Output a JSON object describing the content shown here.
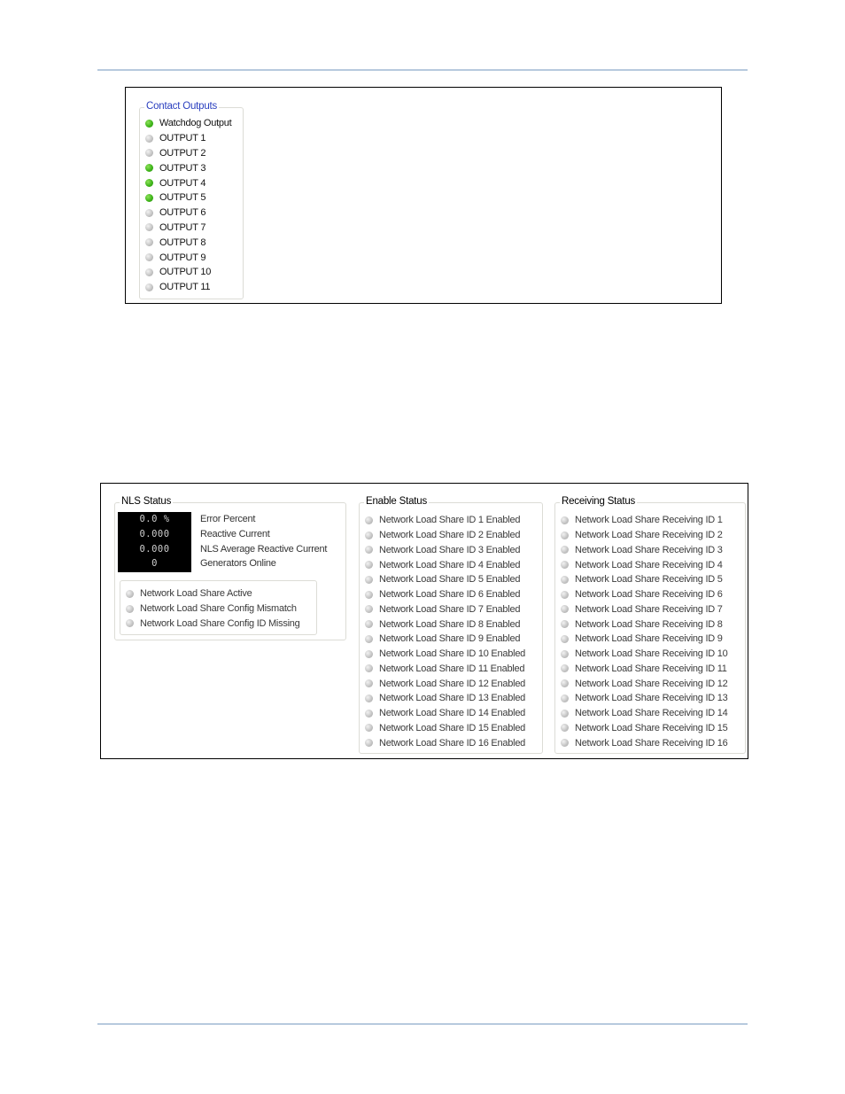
{
  "colors": {
    "led_on": "#3fb51a",
    "led_off": "#c6c6c6",
    "group_title_blue": "#2a3fbf",
    "page_rule": "#b7c9de",
    "meter_background": "#000000"
  },
  "contact_outputs": {
    "title": "Contact Outputs",
    "items": [
      {
        "label": "Watchdog Output",
        "state": "on"
      },
      {
        "label": "OUTPUT 1",
        "state": "off"
      },
      {
        "label": "OUTPUT 2",
        "state": "off"
      },
      {
        "label": "OUTPUT 3",
        "state": "on"
      },
      {
        "label": "OUTPUT 4",
        "state": "on"
      },
      {
        "label": "OUTPUT 5",
        "state": "on"
      },
      {
        "label": "OUTPUT 6",
        "state": "off"
      },
      {
        "label": "OUTPUT 7",
        "state": "off"
      },
      {
        "label": "OUTPUT 8",
        "state": "off"
      },
      {
        "label": "OUTPUT 9",
        "state": "off"
      },
      {
        "label": "OUTPUT 10",
        "state": "off"
      },
      {
        "label": "OUTPUT 11",
        "state": "off"
      }
    ]
  },
  "nls_status": {
    "title": "NLS Status",
    "meters": [
      {
        "value": "0.0 %",
        "label": "Error Percent"
      },
      {
        "value": "0.000",
        "label": "Reactive Current"
      },
      {
        "value": "0.000",
        "label": "NLS Average Reactive Current"
      },
      {
        "value": "0",
        "label": "Generators Online"
      }
    ],
    "indicators": [
      {
        "label": "Network Load Share Active",
        "state": "off"
      },
      {
        "label": "Network Load Share Config Mismatch",
        "state": "off"
      },
      {
        "label": "Network Load Share Config ID Missing",
        "state": "off"
      }
    ]
  },
  "enable_status": {
    "title": "Enable Status",
    "items": [
      {
        "label": "Network Load Share ID 1 Enabled",
        "state": "off"
      },
      {
        "label": "Network Load Share ID 2 Enabled",
        "state": "off"
      },
      {
        "label": "Network Load Share ID 3 Enabled",
        "state": "off"
      },
      {
        "label": "Network Load Share ID 4 Enabled",
        "state": "off"
      },
      {
        "label": "Network Load Share ID 5 Enabled",
        "state": "off"
      },
      {
        "label": "Network Load Share ID 6 Enabled",
        "state": "off"
      },
      {
        "label": "Network Load Share ID 7 Enabled",
        "state": "off"
      },
      {
        "label": "Network Load Share ID 8 Enabled",
        "state": "off"
      },
      {
        "label": "Network Load Share ID 9 Enabled",
        "state": "off"
      },
      {
        "label": "Network Load Share ID 10 Enabled",
        "state": "off"
      },
      {
        "label": "Network Load Share ID 11 Enabled",
        "state": "off"
      },
      {
        "label": "Network Load Share ID 12 Enabled",
        "state": "off"
      },
      {
        "label": "Network Load Share ID 13 Enabled",
        "state": "off"
      },
      {
        "label": "Network Load Share ID 14 Enabled",
        "state": "off"
      },
      {
        "label": "Network Load Share ID 15 Enabled",
        "state": "off"
      },
      {
        "label": "Network Load Share ID 16 Enabled",
        "state": "off"
      }
    ]
  },
  "receiving_status": {
    "title": "Receiving Status",
    "items": [
      {
        "label": "Network Load Share Receiving ID 1",
        "state": "off"
      },
      {
        "label": "Network Load Share Receiving ID 2",
        "state": "off"
      },
      {
        "label": "Network Load Share Receiving ID 3",
        "state": "off"
      },
      {
        "label": "Network Load Share Receiving ID 4",
        "state": "off"
      },
      {
        "label": "Network Load Share Receiving ID 5",
        "state": "off"
      },
      {
        "label": "Network Load Share Receiving ID 6",
        "state": "off"
      },
      {
        "label": "Network Load Share Receiving ID 7",
        "state": "off"
      },
      {
        "label": "Network Load Share Receiving ID 8",
        "state": "off"
      },
      {
        "label": "Network Load Share Receiving ID 9",
        "state": "off"
      },
      {
        "label": "Network Load Share Receiving ID 10",
        "state": "off"
      },
      {
        "label": "Network Load Share Receiving ID 11",
        "state": "off"
      },
      {
        "label": "Network Load Share Receiving ID 12",
        "state": "off"
      },
      {
        "label": "Network Load Share Receiving ID 13",
        "state": "off"
      },
      {
        "label": "Network Load Share Receiving ID 14",
        "state": "off"
      },
      {
        "label": "Network Load Share Receiving ID 15",
        "state": "off"
      },
      {
        "label": "Network Load Share Receiving ID 16",
        "state": "off"
      }
    ]
  }
}
